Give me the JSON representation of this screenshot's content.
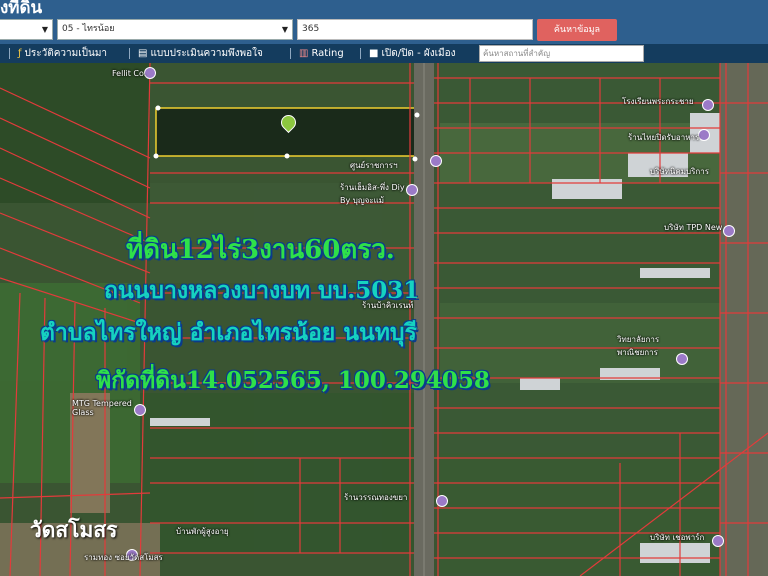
{
  "header": {
    "title": "งที่ดิน",
    "district_select": {
      "value": "",
      "chevron": "chevron-down-icon"
    },
    "subdistrict_select": {
      "value": "05 - ไทรน้อย",
      "chevron": "chevron-down-icon"
    },
    "parcel_input": {
      "value": "365"
    },
    "search_button": "ค้นหาข้อมูล"
  },
  "toolbar": {
    "items": [
      {
        "label": "ประวัติความเป็นมา",
        "icon": "history-icon"
      },
      {
        "label": "แบบประเมินความพึงพอใจ",
        "icon": "document-icon"
      },
      {
        "label": "Rating",
        "icon": "chart-icon"
      },
      {
        "label": "เปิด/ปิด - ผังเมือง",
        "icon": "checkbox-icon"
      }
    ],
    "place_search": {
      "placeholder": "ค้นหาสถานที่สำคัญ"
    }
  },
  "map": {
    "overlay_lines": [
      "ที่ดิน12ไร่3งาน60ตรว.",
      "ถนนบางหลวงบางบท  บบ.5031",
      "ตำบลไทรใหญ่ อำเภอไทรน้อย นนทบุรี",
      "พิกัดที่ดิน14.052565, 100.294058"
    ],
    "temple_label": "วัดสโมสร",
    "poi": [
      "Fellit Co.",
      "โรงเรียนพระกระชาย",
      "ร้านไทยปิดรับอาหาร",
      "บริษัทนิคมบริการ",
      "ศูนย์ราชการฯ",
      "ร้านเฮ็มอิส-พึ่ง Diy By บุญจะแม้",
      "บริษัท TPD New",
      "ร้านบ้าคิวเรนท์",
      "วิทยาลัยการพาณิชยการ",
      "MTG Tempered Glass",
      "ร้านวรรณทองขยา",
      "บริษัท เชอพาร์ก",
      "รามทอง ซอยวัดสโมสร",
      "บ้านพักผู้สูงอายุ"
    ],
    "colors": {
      "parcel_lines": "#e23b3b",
      "overlay_cyan": "#16d2c0",
      "overlay_green": "#2fe04a"
    }
  }
}
